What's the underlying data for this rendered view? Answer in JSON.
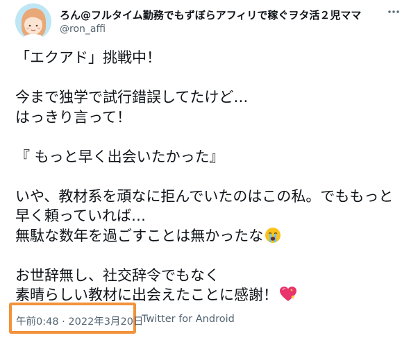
{
  "author": {
    "display_name": "ろん@フルタイム勤務でもずぼらアフィリで稼ぐヲタ活２児ママ",
    "handle": "@ron_affi"
  },
  "tweet": {
    "line1": "「エクアド」挑戦中！",
    "line2": "今まで独学で試行錯誤してたけど…",
    "line3": "はっきり言って！",
    "line4": "『 もっと早く出会いたかった』",
    "line5": "いや、教材系を頑なに拒んでいたのはこの私。でももっと早く頼っていれば…",
    "line6": "無駄な数年を過ごすことは無かったな",
    "line6_emoji": "crying-face-icon",
    "line7": "お世辞無し、社交辞令でもなく",
    "line8": "素晴らしい教材に出会えたことに感謝！",
    "line8_emoji": "sparkling-heart-icon"
  },
  "meta": {
    "timestamp": "午前0:48 · 2022年3月20日",
    "separator": "·",
    "source": "Twitter for Android"
  },
  "colors": {
    "text": "#0f1419",
    "muted": "#536471",
    "highlight": "#f2923a"
  }
}
